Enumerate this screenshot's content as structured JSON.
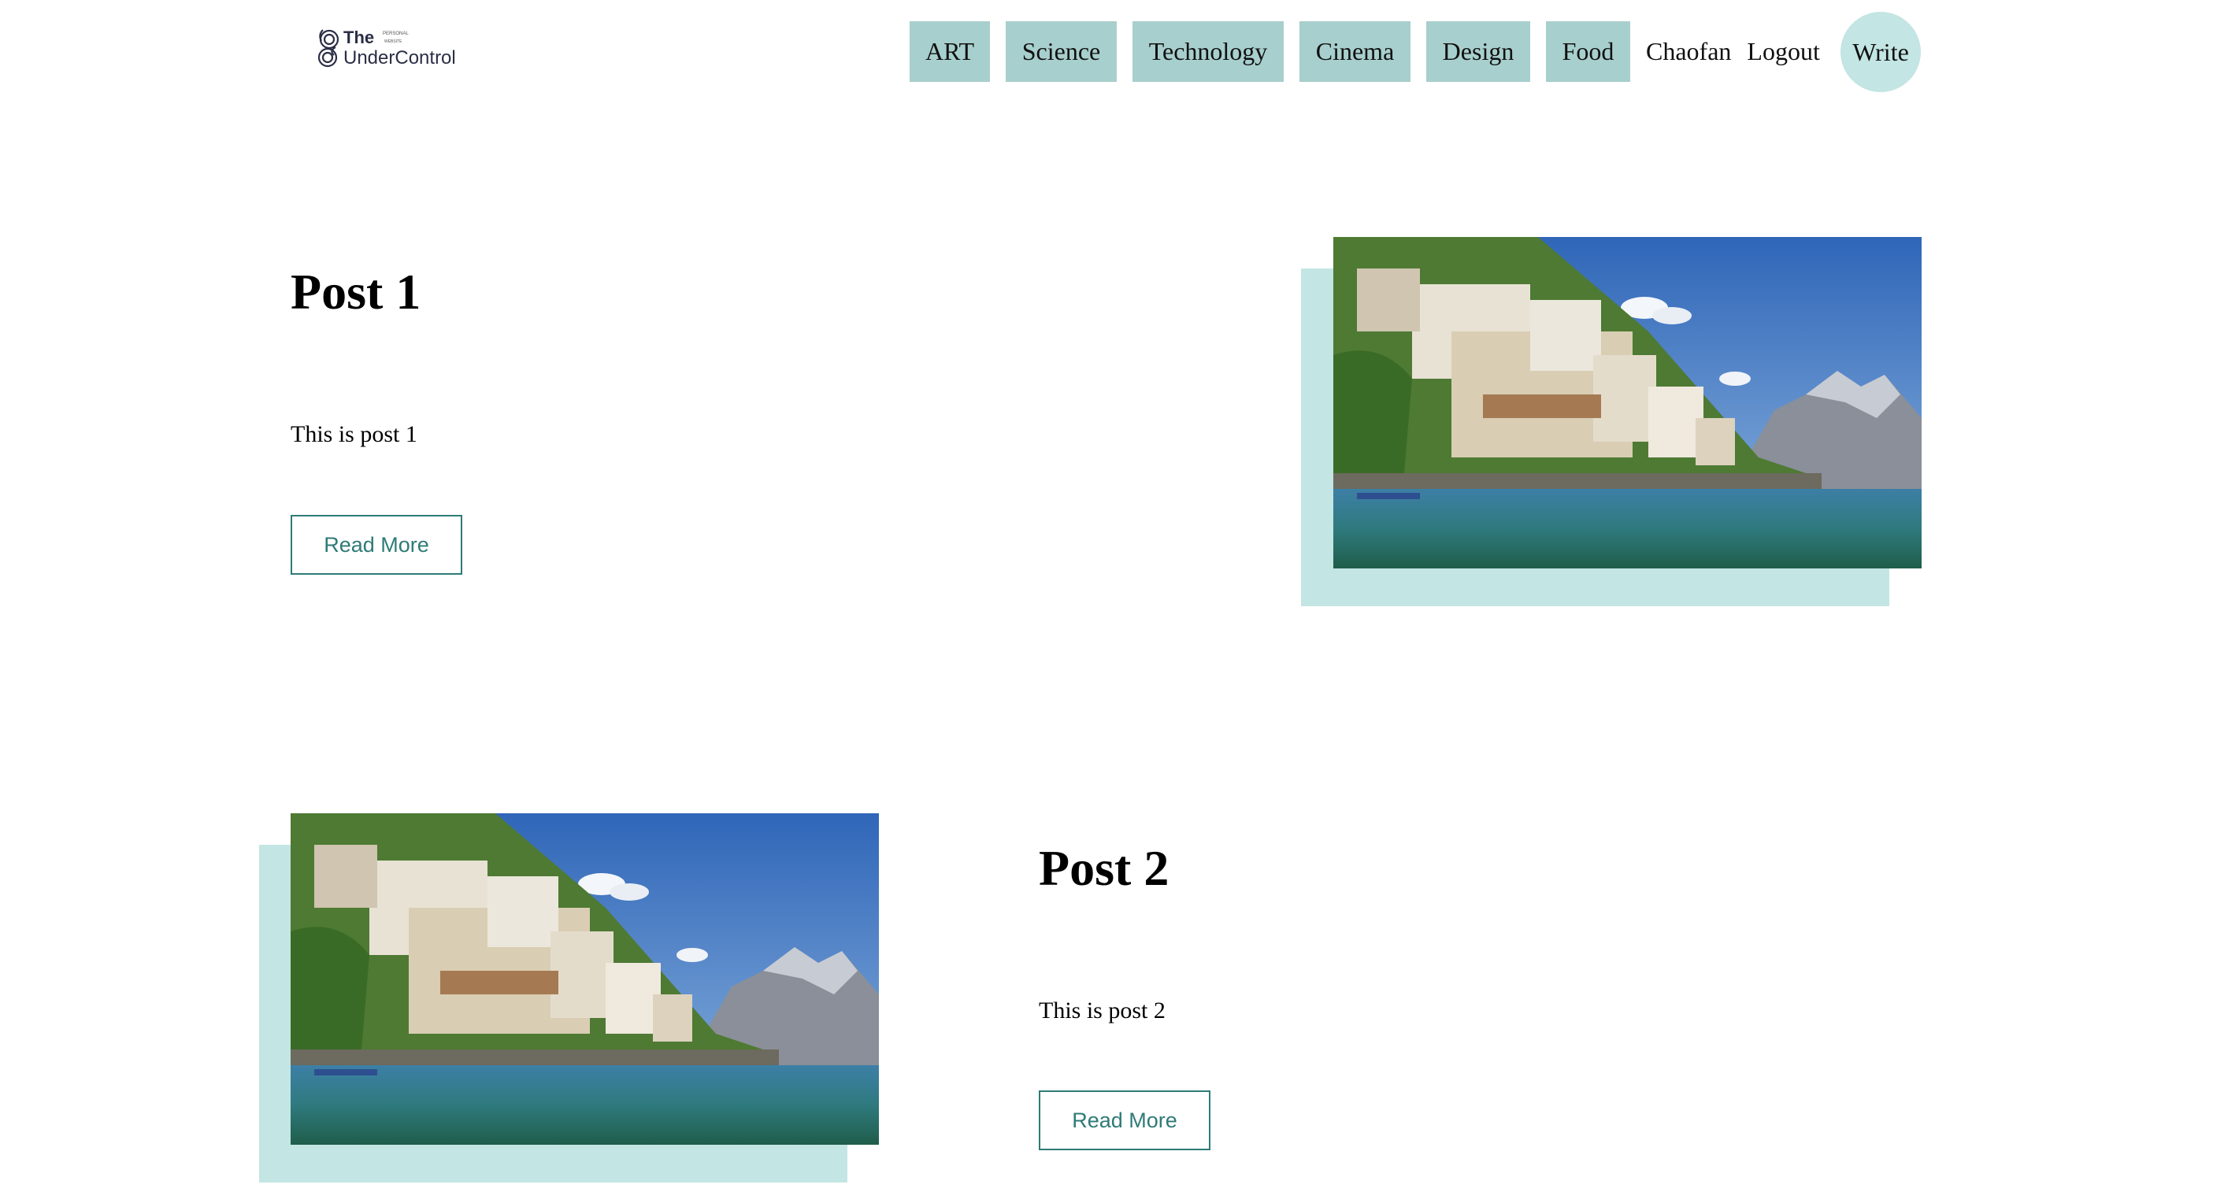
{
  "brand": {
    "line1": "The",
    "line2": "UnderControl",
    "tagline_top": "PERSONAL",
    "tagline_bottom": "WEBSITE"
  },
  "nav": {
    "categories": [
      "ART",
      "Science",
      "Technology",
      "Cinema",
      "Design",
      "Food"
    ],
    "user_name": "Chaofan",
    "logout_label": "Logout",
    "write_label": "Write"
  },
  "posts": [
    {
      "title": "Post 1",
      "body": "This is post 1",
      "read_more_label": "Read More"
    },
    {
      "title": "Post 2",
      "body": "This is post 2",
      "read_more_label": "Read More"
    }
  ],
  "colors": {
    "category_bg": "#a7cfcd",
    "accent_light": "#c3e5e3",
    "accent_dark": "#2e7b77"
  }
}
